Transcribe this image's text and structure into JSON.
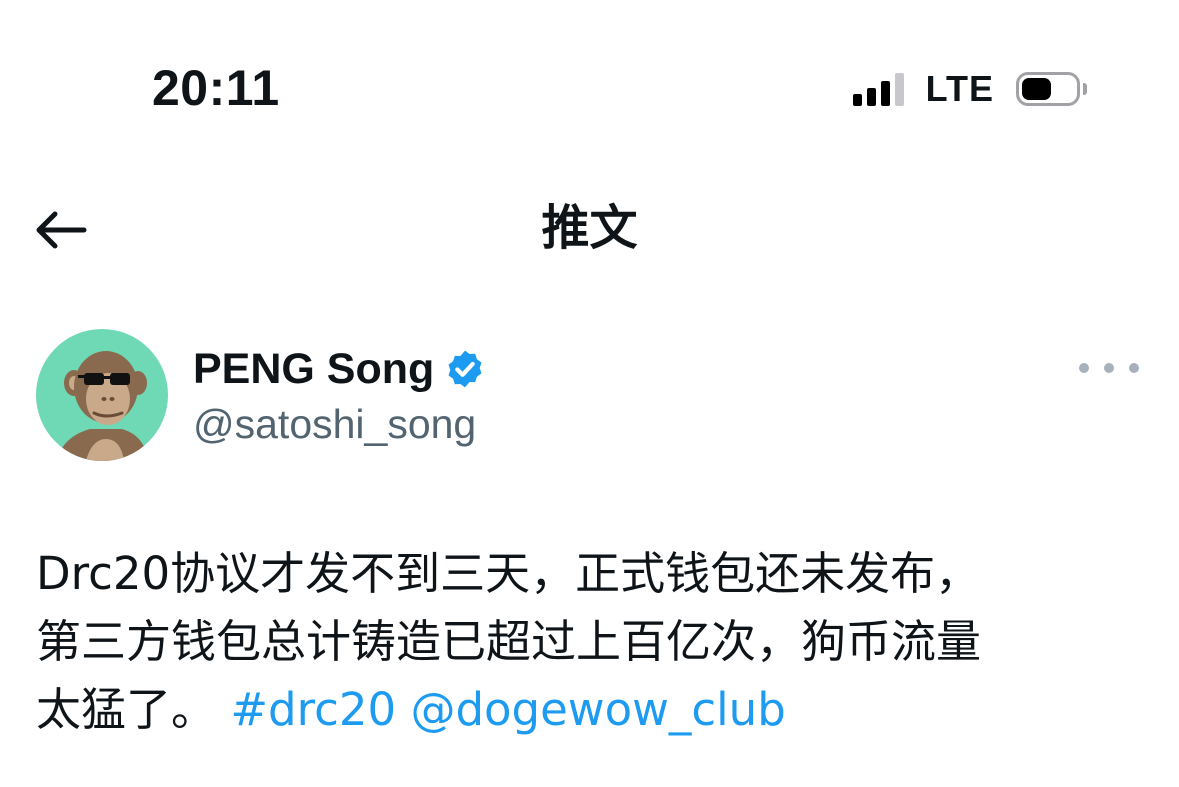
{
  "status_bar": {
    "time": "20:11",
    "network": "LTE",
    "signal_bars_filled": 3,
    "signal_bars_total": 4,
    "battery_level_fraction": 0.55
  },
  "header": {
    "back_icon": "arrow-left-icon",
    "title": "推文"
  },
  "author": {
    "name": "PENG Song",
    "handle": "@satoshi_song",
    "verified": true,
    "avatar_background": "#6fd8b5",
    "verified_color": "#1d9bf0"
  },
  "more_icon": "more-horizontal-icon",
  "tweet": {
    "line1": "Drc20协议才发不到三天，正式钱包还未发布，",
    "line2": "第三方钱包总计铸造已超过上百亿次，狗币流量",
    "line3_text": "太猛了。",
    "hashtag": "#drc20",
    "mention": "@dogewow_club",
    "link_color": "#1d9bf0"
  }
}
